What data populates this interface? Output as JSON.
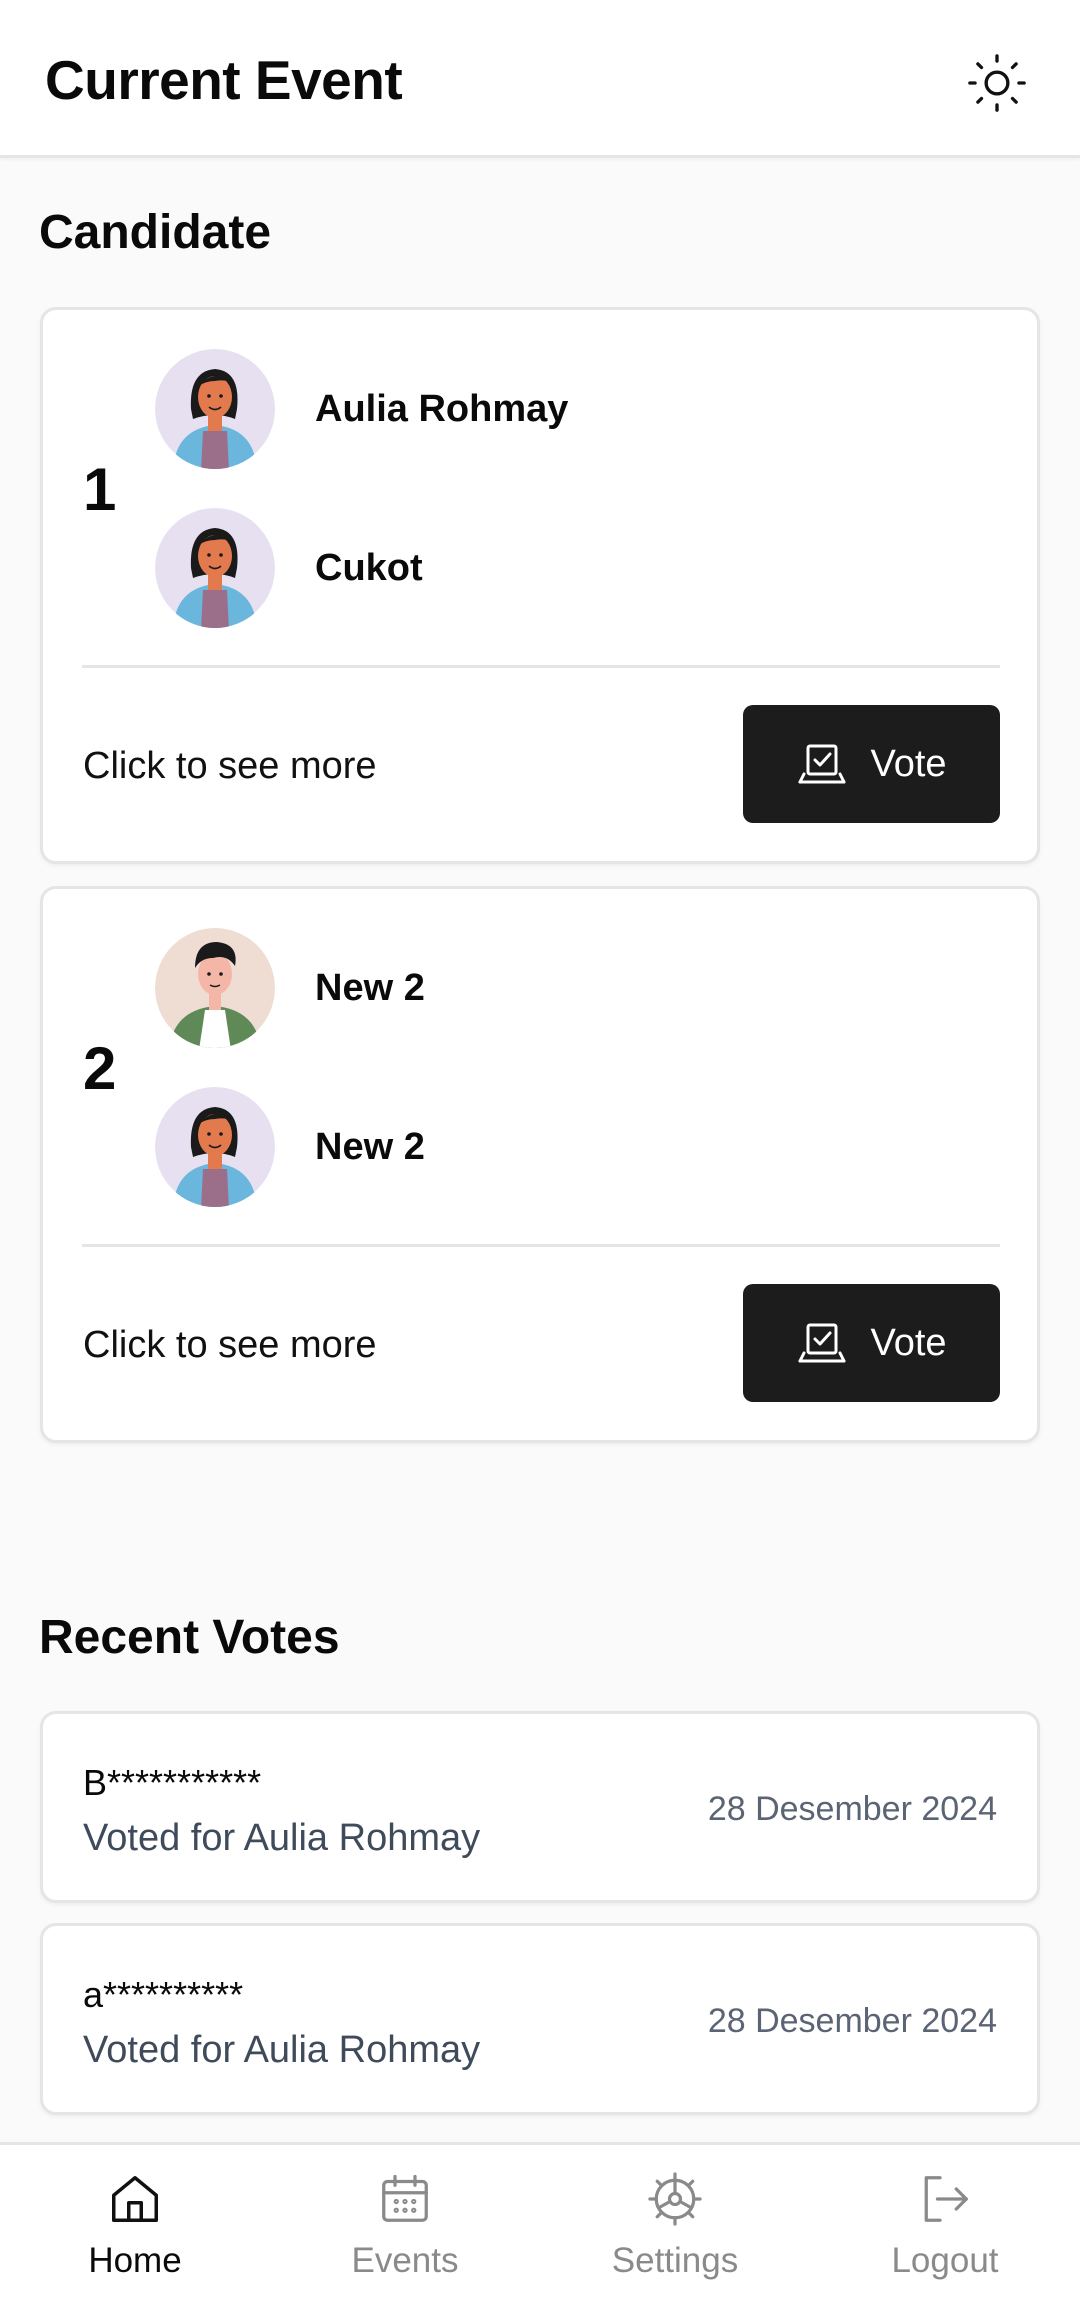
{
  "header": {
    "title": "Current Event",
    "theme_icon": "sun-icon"
  },
  "candidates_section": {
    "title": "Candidate",
    "see_more_label": "Click to see more",
    "vote_label": "Vote",
    "vote_icon": "vote-box-icon",
    "items": [
      {
        "number": "1",
        "members": [
          {
            "name": "Aulia Rohmay",
            "avatar": "woman-avatar"
          },
          {
            "name": "Cukot",
            "avatar": "woman-avatar"
          }
        ]
      },
      {
        "number": "2",
        "members": [
          {
            "name": "New 2",
            "avatar": "man-avatar"
          },
          {
            "name": "New 2",
            "avatar": "woman-avatar"
          }
        ]
      }
    ]
  },
  "recent_votes": {
    "title": "Recent Votes",
    "items": [
      {
        "voter": "B***********",
        "voted_for": "Voted for Aulia Rohmay",
        "date": "28 Desember 2024"
      },
      {
        "voter": "a**********",
        "voted_for": "Voted for Aulia Rohmay",
        "date": "28 Desember 2024"
      }
    ]
  },
  "nav": {
    "items": [
      {
        "label": "Home",
        "icon": "home-icon",
        "active": true
      },
      {
        "label": "Events",
        "icon": "calendar-icon",
        "active": false
      },
      {
        "label": "Settings",
        "icon": "settings-icon",
        "active": false
      },
      {
        "label": "Logout",
        "icon": "logout-icon",
        "active": false
      }
    ]
  },
  "colors": {
    "background": "#fafafa",
    "card": "#ffffff",
    "border": "#e5e5e5",
    "button": "#1c1c1c",
    "muted_text": "#3f4a5a",
    "nav_inactive": "#8a8a8a"
  }
}
